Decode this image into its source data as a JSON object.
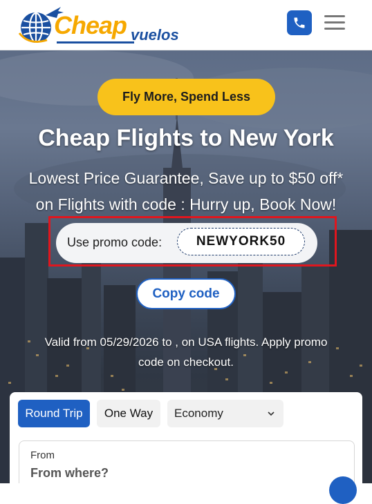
{
  "header": {
    "logo_primary": "Cheap",
    "logo_secondary": "vuelos",
    "phone_icon": "phone-icon",
    "menu_icon": "hamburger-menu-icon"
  },
  "hero": {
    "tagline": "Fly More, Spend Less",
    "title": "Cheap Flights to New York",
    "subtitle_line1": "Lowest Price Guarantee, Save up to $50 off*",
    "subtitle_line2": "on Flights with code : Hurry up, Book Now!",
    "promo_label": "Use promo code:",
    "promo_code": "NEWYORK50",
    "copy_label": "Copy code",
    "valid_line1": "Valid from 05/29/2026 to , on USA flights. Apply promo",
    "valid_line2": "code on checkout."
  },
  "search": {
    "trip_types": [
      "Round Trip",
      "One Way"
    ],
    "selected_trip_type": "Round Trip",
    "cabin_class": "Economy",
    "from_label": "From",
    "from_placeholder": "From where?"
  },
  "colors": {
    "brand_blue": "#1f60c2",
    "brand_yellow": "#f8c21b",
    "logo_orange": "#f6a800",
    "highlight_red": "#e0161e"
  }
}
